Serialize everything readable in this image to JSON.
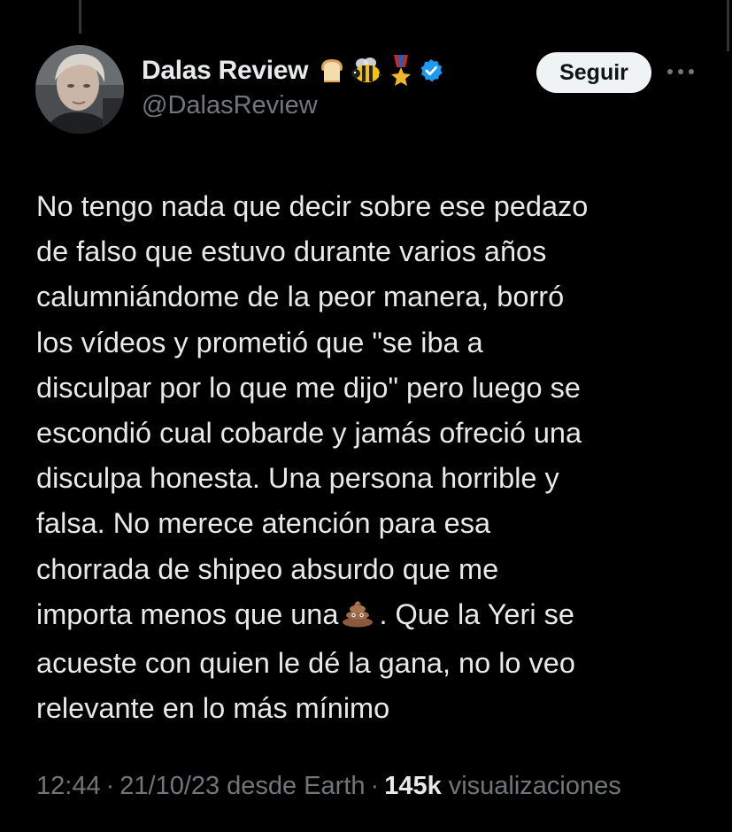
{
  "author": {
    "display_name": "Dalas Review",
    "handle": "@DalasReview",
    "badges": [
      "bread-emoji",
      "bee-emoji",
      "military-medal-emoji",
      "verified-badge"
    ],
    "verified_color": "#1d9bf0"
  },
  "actions": {
    "follow_label": "Seguir",
    "more_icon": "more-horizontal-icon"
  },
  "tweet": {
    "lines": [
      "No tengo nada que decir sobre ese pedazo",
      "de falso que estuvo durante varios años",
      "calumniándome de la peor manera, borró",
      "los vídeos y prometió que \"se iba a",
      "disculpar por lo que me dijo\" pero luego se",
      "escondió cual cobarde y jamás ofreció una",
      "disculpa honesta. Una persona horrible y",
      "falsa. No merece atención para esa",
      "chorrada de shipeo absurdo que me",
      "importa menos que una",
      ". Que la Yeri se",
      "acueste con quien le dé la gana, no lo veo",
      "relevante en lo más mínimo"
    ],
    "inline_emoji": "pile-of-poo-emoji"
  },
  "meta": {
    "time": "12:44",
    "date": "21/10/23",
    "source": "desde Earth",
    "views_count": "145k",
    "views_label": "visualizaciones",
    "separator": "·"
  },
  "colors": {
    "background": "#000000",
    "text": "#e7e9ea",
    "secondary_text": "#71767b",
    "follow_bg": "#eff3f4"
  }
}
